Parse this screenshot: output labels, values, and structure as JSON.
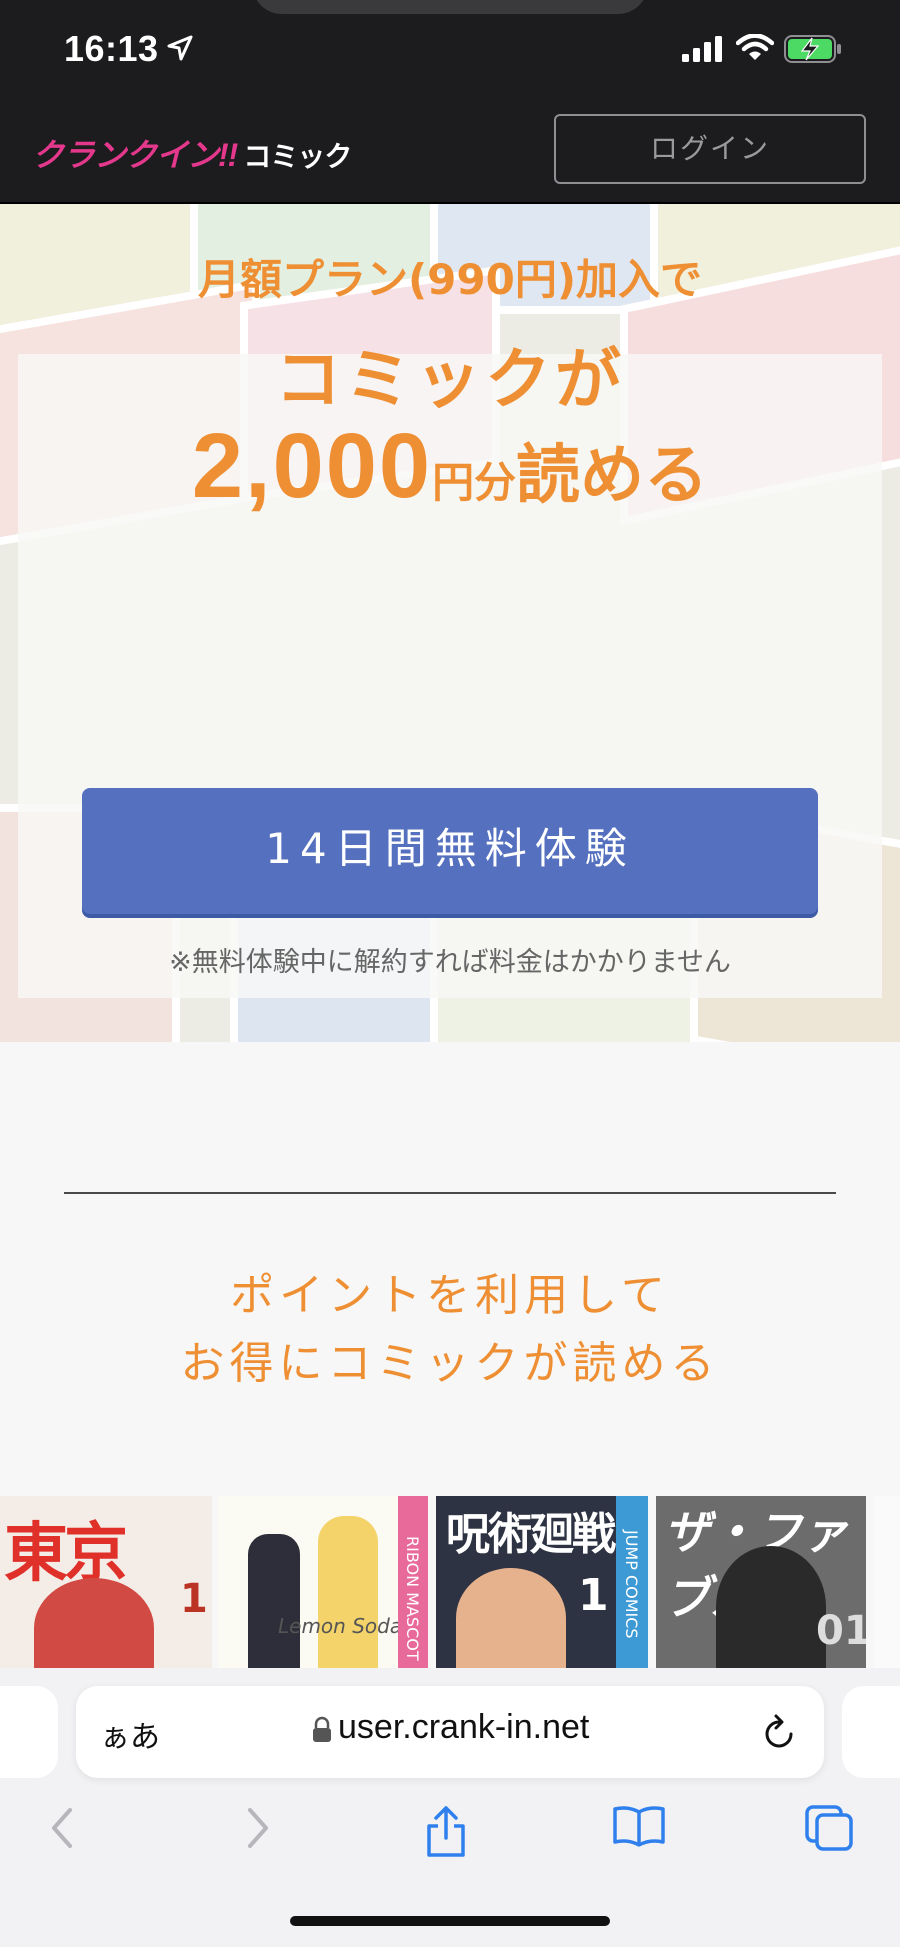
{
  "status_bar": {
    "time": "16:13"
  },
  "header": {
    "logo_main": "クランクイン",
    "logo_mark": "!!",
    "logo_sub": "コミック",
    "login_label": "ログイン"
  },
  "hero": {
    "line1": "月額プラン(990円)加入で",
    "line2": "コミックが",
    "amount": "2,000",
    "unit": "円分",
    "read": "読める",
    "button_label": "14日間無料体験",
    "notice": "※無料体験中に解約すれば料金はかかりません"
  },
  "points": {
    "heading_line1": "ポイントを利用して",
    "heading_line2": "お得にコミックが読める"
  },
  "covers": [
    {
      "title": "東京",
      "volume": "1"
    },
    {
      "title": "Lemon Soda",
      "label": "RIBON MASCOT"
    },
    {
      "title": "呪術廻戦",
      "volume": "1",
      "label": "JUMP COMICS"
    },
    {
      "title": "ザ・ファブル",
      "volume": "01"
    }
  ],
  "browser": {
    "aa_label": "ぁあ",
    "url": "user.crank-in.net"
  }
}
